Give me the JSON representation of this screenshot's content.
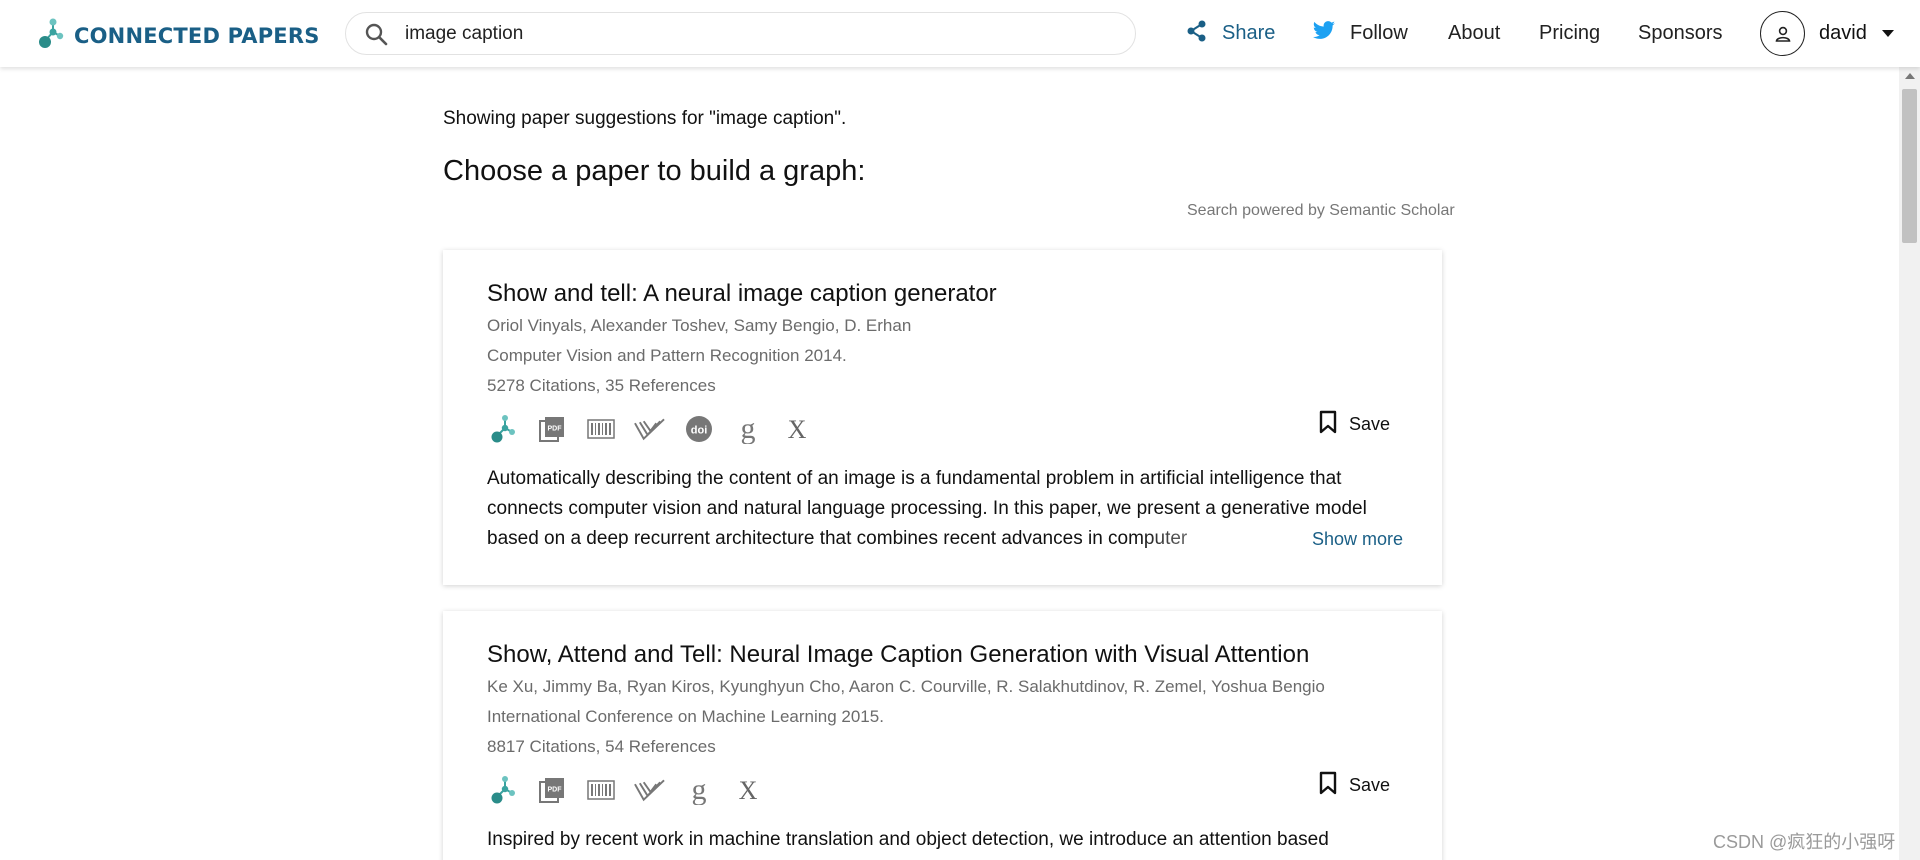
{
  "brand": {
    "name": "CONNECTED PAPERS",
    "color": "#1a5f86",
    "accent": "#3aa3a0"
  },
  "search": {
    "value": "image caption"
  },
  "nav": {
    "share": "Share",
    "follow": "Follow",
    "about": "About",
    "pricing": "Pricing",
    "sponsors": "Sponsors"
  },
  "user": {
    "name": "david"
  },
  "main": {
    "showing": "Showing paper suggestions for \"image caption\".",
    "choose": "Choose a paper to build a graph:",
    "powered": "Search powered by Semantic Scholar"
  },
  "papers": [
    {
      "title": "Show and tell: A neural image caption generator",
      "authors": "Oriol Vinyals, Alexander Toshev, Samy Bengio, D. Erhan",
      "venue": "Computer Vision and Pattern Recognition 2014.",
      "citations": "5278 Citations, 35 References",
      "save": "Save",
      "abstract": "Automatically describing the content of an image is a fundamental problem in artificial intelligence that connects computer vision and natural language processing. In this paper, we present a generative model based on a deep recurrent architecture that combines recent advances in computer",
      "show_more": "Show more",
      "icons": [
        "connected-papers-icon",
        "pdf-icon",
        "barcode-icon",
        "semantic-scholar-icon",
        "doi-icon",
        "google-scholar-icon",
        "x-icon"
      ]
    },
    {
      "title": "Show, Attend and Tell: Neural Image Caption Generation with Visual Attention",
      "authors": "Ke Xu, Jimmy Ba, Ryan Kiros, Kyunghyun Cho, Aaron C. Courville, R. Salakhutdinov, R. Zemel, Yoshua Bengio",
      "venue": "International Conference on Machine Learning 2015.",
      "citations": "8817 Citations, 54 References",
      "save": "Save",
      "abstract": "Inspired by recent work in machine translation and object detection, we introduce an attention based",
      "icons": [
        "connected-papers-icon",
        "pdf-icon",
        "barcode-icon",
        "semantic-scholar-icon",
        "google-scholar-icon",
        "x-icon"
      ]
    }
  ],
  "watermark": "CSDN @疯狂的小强呀"
}
